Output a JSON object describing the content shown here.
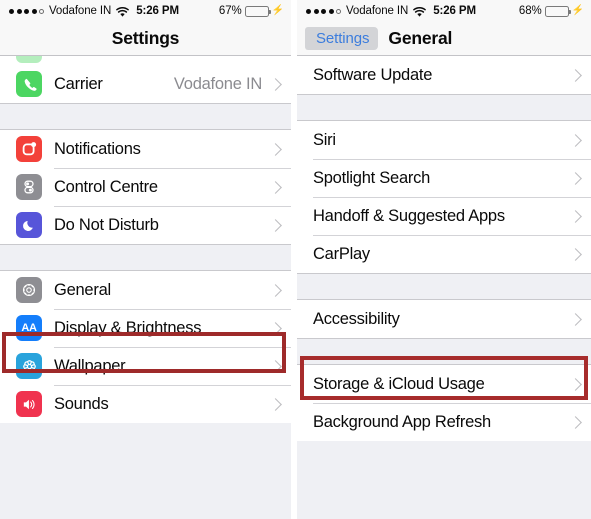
{
  "left_panel": {
    "status_bar": {
      "signal_dots_filled": 4,
      "signal_dots_total": 5,
      "carrier": "Vodafone IN",
      "wifi_icon": "wifi-icon",
      "time": "5:26 PM",
      "battery_percent": "67%",
      "battery_level": 67,
      "charging_icon": "bolt-icon"
    },
    "nav": {
      "title": "Settings"
    },
    "groups": [
      {
        "rows": [
          {
            "label": "Carrier",
            "value": "Vodafone IN",
            "icon": "phone-icon",
            "icon_class": "ic-phone",
            "chevron": true
          }
        ]
      },
      {
        "rows": [
          {
            "label": "Notifications",
            "value": "",
            "icon": "notifications-icon",
            "icon_class": "ic-notif",
            "chevron": true
          },
          {
            "label": "Control Centre",
            "value": "",
            "icon": "control-centre-icon",
            "icon_class": "ic-cc",
            "chevron": true
          },
          {
            "label": "Do Not Disturb",
            "value": "",
            "icon": "moon-icon",
            "icon_class": "ic-dnd",
            "chevron": true
          }
        ]
      },
      {
        "rows": [
          {
            "label": "General",
            "value": "",
            "icon": "gear-icon",
            "icon_class": "ic-gear",
            "chevron": true,
            "highlighted": true
          },
          {
            "label": "Display & Brightness",
            "value": "",
            "icon": "display-brightness-icon",
            "icon_class": "ic-disp",
            "chevron": true
          },
          {
            "label": "Wallpaper",
            "value": "",
            "icon": "wallpaper-icon",
            "icon_class": "ic-wall",
            "chevron": true
          },
          {
            "label": "Sounds",
            "value": "",
            "icon": "sounds-icon",
            "icon_class": "ic-snd",
            "chevron": true
          }
        ]
      }
    ]
  },
  "right_panel": {
    "status_bar": {
      "signal_dots_filled": 4,
      "signal_dots_total": 5,
      "carrier": "Vodafone IN",
      "wifi_icon": "wifi-icon",
      "time": "5:26 PM",
      "battery_percent": "68%",
      "battery_level": 68,
      "charging_icon": "bolt-icon"
    },
    "nav": {
      "back_label": "Settings",
      "title": "General"
    },
    "groups": [
      {
        "rows": [
          {
            "label": "Software Update",
            "chevron": true
          }
        ]
      },
      {
        "rows": [
          {
            "label": "Siri",
            "chevron": true
          },
          {
            "label": "Spotlight Search",
            "chevron": true
          },
          {
            "label": "Handoff & Suggested Apps",
            "chevron": true
          },
          {
            "label": "CarPlay",
            "chevron": true
          }
        ]
      },
      {
        "rows": [
          {
            "label": "Accessibility",
            "chevron": true,
            "highlighted": true
          }
        ]
      },
      {
        "rows": [
          {
            "label": "Storage & iCloud Usage",
            "chevron": true
          },
          {
            "label": "Background App Refresh",
            "chevron": true
          }
        ]
      }
    ]
  },
  "annotations": {
    "highlight_color_left": "#9e2a2a",
    "highlight_color_right": "#a72c2c"
  }
}
